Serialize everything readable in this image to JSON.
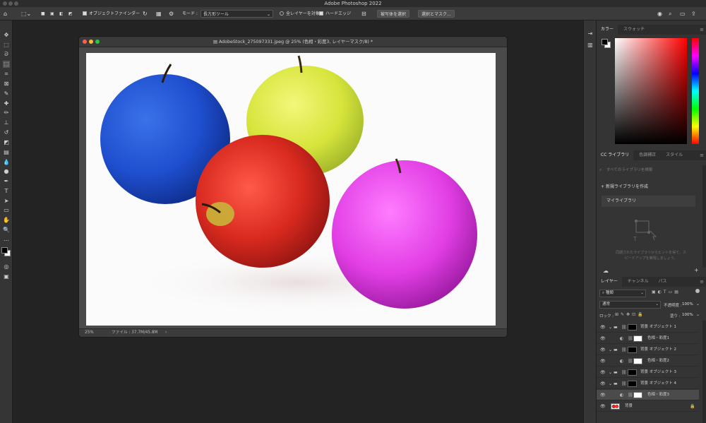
{
  "app": {
    "title": "Adobe Photoshop 2022"
  },
  "options_bar": {
    "object_finder_label": "オブジェクトファインダー",
    "mode_label": "モード :",
    "mode_value": "長方形ツール",
    "all_layers_label": "全レイヤーを対象",
    "hard_edge_label": "ハードエッジ",
    "select_subject_label": "被写体を選択",
    "select_mask_label": "選択とマスク..."
  },
  "document": {
    "title": "AdobeStock_275097331.jpeg @ 25% (色相・彩度3, レイヤーマスク/8) *",
    "zoom": "25%",
    "file_info": "ファイル : 37.7M/45.8M",
    "arrow": "›"
  },
  "color_panel": {
    "tabs": [
      "カラー",
      "スウォッチ"
    ]
  },
  "library_panel": {
    "tabs": [
      "CC ライブラリ",
      "色調補正",
      "スタイル"
    ],
    "search_placeholder": "すべてのライブラリを検索",
    "create_label": "新規ライブラリを作成",
    "my_library": "マイライブラリ",
    "hint_line1": "同期されたライブラリからヒントを得て、ス",
    "hint_line2": "ピードアップを実現しましょう。"
  },
  "layers_panel": {
    "tabs": [
      "レイヤー",
      "チャンネル",
      "パス"
    ],
    "filter_kind": "種類",
    "blend_mode": "通常",
    "opacity_label": "不透明度 :",
    "opacity_value": "100%",
    "lock_label": "ロック :",
    "fill_label": "塗り :",
    "fill_value": "100%",
    "layers": [
      {
        "name": "背景 オブジェクト 1",
        "type": "group"
      },
      {
        "name": "色相・彩度1",
        "type": "adjustment"
      },
      {
        "name": "背景 オブジェクト 2",
        "type": "group"
      },
      {
        "name": "色相・彩度2",
        "type": "adjustment"
      },
      {
        "name": "背景 オブジェクト 3",
        "type": "group"
      },
      {
        "name": "背景 オブジェクト 4",
        "type": "group"
      },
      {
        "name": "色相・彩度3",
        "type": "adjustment"
      },
      {
        "name": "背景",
        "type": "background"
      }
    ]
  },
  "colors": {
    "foreground": "#000000",
    "background": "#ffffff"
  }
}
